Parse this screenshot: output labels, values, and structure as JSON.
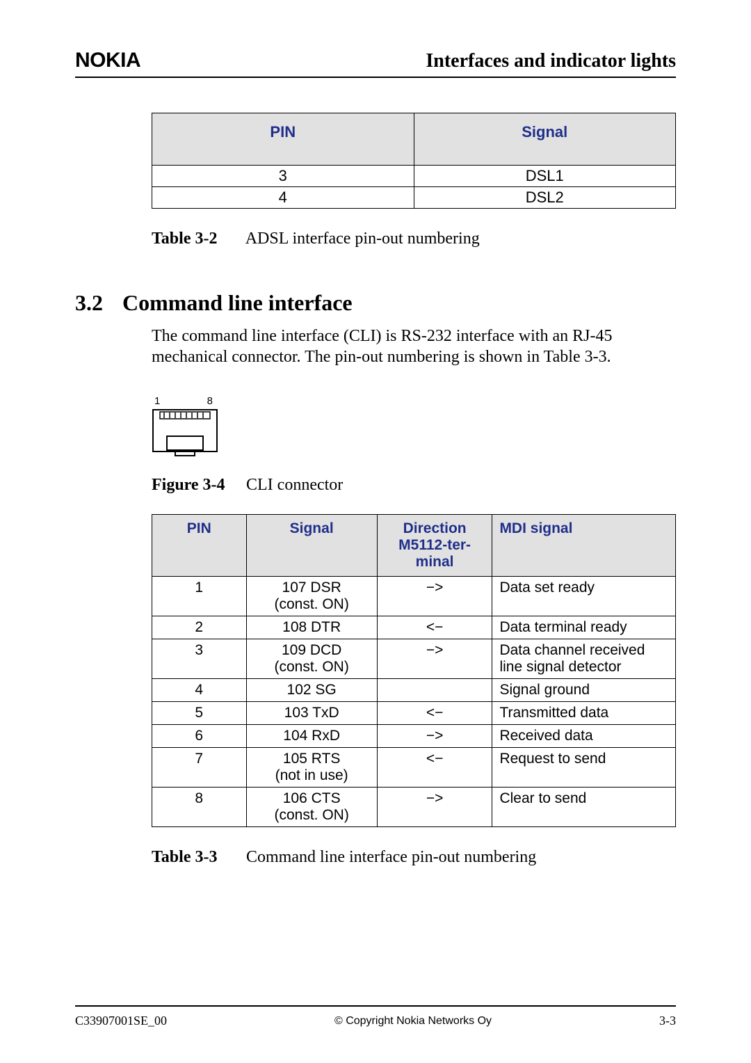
{
  "header": {
    "brand": "NOKIA",
    "chapter_title": "Interfaces and indicator lights"
  },
  "table1": {
    "headers": [
      "PIN",
      "Signal"
    ],
    "rows": [
      {
        "pin": "3",
        "signal": "DSL1"
      },
      {
        "pin": "4",
        "signal": "DSL2"
      }
    ],
    "caption_label": "Table 3-2",
    "caption_text": "ADSL interface pin-out numbering"
  },
  "section": {
    "number": "3.2",
    "title": "Command line interface",
    "paragraph": "The command line interface (CLI) is RS-232 interface with an RJ-45 mechanical connector. The pin-out numbering is shown in Table 3-3."
  },
  "figure": {
    "pin_left": "1",
    "pin_right": "8",
    "caption_label": "Figure 3-4",
    "caption_text": "CLI connector"
  },
  "table2": {
    "headers": {
      "pin": "PIN",
      "signal": "Signal",
      "direction_l1": "Direction",
      "direction_l2": "M5112-ter-",
      "direction_l3": "minal",
      "mdi": "MDI signal"
    },
    "rows": [
      {
        "pin": "1",
        "signal_l1": "107 DSR",
        "signal_l2": "(const. ON)",
        "dir": "−>",
        "mdi": "Data set ready"
      },
      {
        "pin": "2",
        "signal_l1": "108 DTR",
        "signal_l2": "",
        "dir": "<−",
        "mdi": "Data terminal ready"
      },
      {
        "pin": "3",
        "signal_l1": "109 DCD",
        "signal_l2": "(const. ON)",
        "dir": "−>",
        "mdi": "Data channel received line signal detector"
      },
      {
        "pin": "4",
        "signal_l1": "102 SG",
        "signal_l2": "",
        "dir": "",
        "mdi": "Signal ground"
      },
      {
        "pin": "5",
        "signal_l1": "103 TxD",
        "signal_l2": "",
        "dir": "<−",
        "mdi": "Transmitted data"
      },
      {
        "pin": "6",
        "signal_l1": "104 RxD",
        "signal_l2": "",
        "dir": "−>",
        "mdi": "Received data"
      },
      {
        "pin": "7",
        "signal_l1": "105 RTS",
        "signal_l2": "(not in use)",
        "dir": "<−",
        "mdi": "Request to send"
      },
      {
        "pin": "8",
        "signal_l1": "106 CTS",
        "signal_l2": "(const. ON)",
        "dir": "−>",
        "mdi": "Clear to send"
      }
    ],
    "caption_label": "Table 3-3",
    "caption_text": "Command line interface pin-out numbering"
  },
  "footer": {
    "doc_id": "C33907001SE_00",
    "copyright": "© Copyright Nokia Networks Oy",
    "page_num": "3-3"
  }
}
